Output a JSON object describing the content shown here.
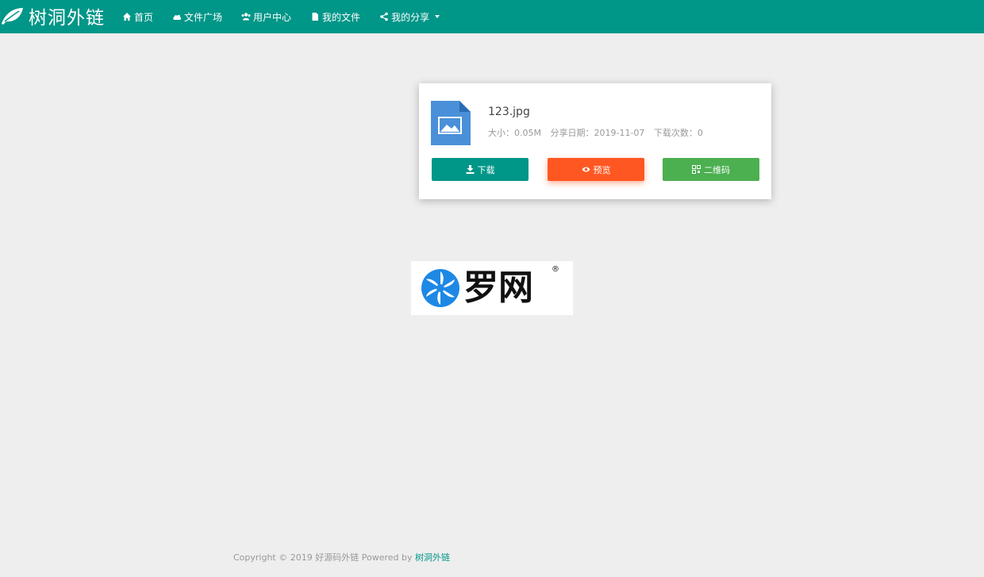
{
  "colors": {
    "primary": "#009688",
    "preview_button": "#ff5722",
    "qrcode_button": "#4caf50",
    "background": "#eeeeee",
    "file_icon": "#4a90d9"
  },
  "navbar": {
    "brand": "树洞外链",
    "items": [
      {
        "icon": "home-icon",
        "label": "首页"
      },
      {
        "icon": "cloud-icon",
        "label": "文件广场"
      },
      {
        "icon": "users-icon",
        "label": "用户中心"
      },
      {
        "icon": "file-icon",
        "label": "我的文件"
      },
      {
        "icon": "share-icon",
        "label": "我的分享",
        "dropdown": true
      }
    ]
  },
  "file": {
    "icon": "image-file-icon",
    "name": "123.jpg",
    "size_label": "大小：0.05M",
    "date_label": "分享日期：2019-11-07",
    "downloads_label": "下载次数：0"
  },
  "buttons": {
    "download": "下载",
    "preview": "预览",
    "qrcode": "二维码"
  },
  "preview_image": {
    "text": "罗网",
    "registered_mark": "®"
  },
  "footer": {
    "copyright": "Copyright © 2019 好源码外链 Powered by ",
    "link": "树洞外链"
  }
}
